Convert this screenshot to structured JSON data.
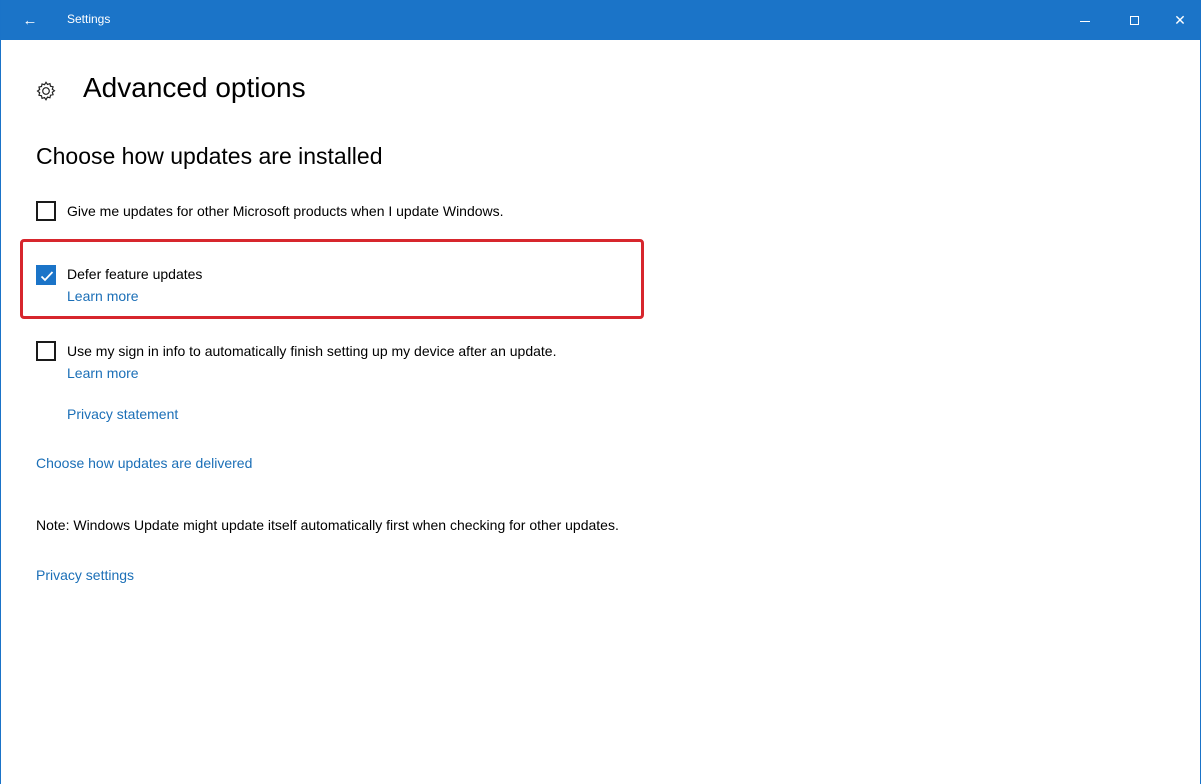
{
  "window": {
    "title": "Settings",
    "back_icon": "back-arrow-icon",
    "controls": [
      "minimize-icon",
      "maximize-icon",
      "close-icon"
    ],
    "close_glyph": "✕",
    "back_glyph": "←",
    "titlebar_color": "#1b74c8"
  },
  "page": {
    "title": "Advanced options",
    "title_icon": "gear-icon"
  },
  "install_section": {
    "heading": "Choose how updates are installed",
    "options": [
      {
        "label": "Give me updates for other Microsoft products when I update Windows.",
        "checked": false
      },
      {
        "label": "Defer feature updates",
        "checked": true,
        "link": "Learn more",
        "highlighted": true,
        "highlight_color": "#d7262d"
      },
      {
        "label": "Use my sign in info to automatically finish setting up my device after an update.",
        "checked": false,
        "link": "Learn more"
      }
    ],
    "privacy_statement_link": "Privacy statement"
  },
  "delivery_link": "Choose how updates are delivered",
  "note": "Note: Windows Update might update itself automatically first when checking for other updates.",
  "privacy_settings_link": "Privacy settings",
  "colors": {
    "accent": "#1b74c8",
    "link": "#1b6fb7"
  }
}
